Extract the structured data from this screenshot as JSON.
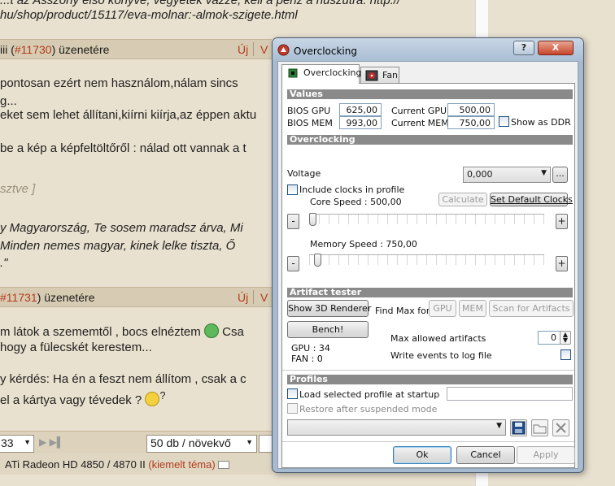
{
  "forum": {
    "top_line1": "...t az Asszony első könyve, vegyétek vázze, kell a pénz a húszutra: http://",
    "top_line2": "hu/shop/product/15117/eva-molnar:-almok-szigete.html",
    "msg1_header_prefix": "iii (",
    "msg1_header_link": "#11730",
    "msg1_header_suffix": ") üzenetére",
    "new_label": "Új",
    "v_label": "V",
    "msg1_line1": "pontosan ezért nem használom,nálam sincs",
    "msg1_line2": "g...",
    "msg1_line3": "eket sem lehet állítani,kiírni kiírja,az éppen aktu",
    "msg1_line4": " be a kép a képfeltöltőről : nálad ott vannak a t",
    "msg1_edited": "sztve ]",
    "sig_line1": "y Magyarország, Te sosem maradsz árva, Mi",
    "sig_line2": "Minden nemes magyar, kinek lelke tiszta, Ő",
    "sig_line3": ".\"",
    "msg2_header_link": "#11731",
    "msg2_header_suffix": ") üzenetére",
    "msg2_line1": "m látok a szememtől , bocs elnéztem",
    "msg2_line1b": "Csa",
    "msg2_line2": "hogy a fülecskét kerestem...",
    "msg2_line3": "y kérdés: Ha én a feszt nem állítom , csak a c",
    "msg2_line4": "el a kártya vagy tévedek ?",
    "msg2_line4b": "?",
    "page_value": "33",
    "per_page": "50 db / növekvő",
    "card_name": "ATi Radeon HD 4850 / 4870 II",
    "card_tag": "(kiemelt téma)"
  },
  "dialog": {
    "title": "Overclocking",
    "help_label": "?",
    "close_label": "X",
    "tabs": [
      {
        "label": "Overclocking",
        "icon": "chip-icon"
      },
      {
        "label": "Fan",
        "icon": "fan-icon"
      }
    ],
    "values_section": "Values",
    "bios_gpu_label": "BIOS GPU",
    "bios_gpu_value": "625,00",
    "bios_mem_label": "BIOS MEM",
    "bios_mem_value": "993,00",
    "current_gpu_label": "Current GPU",
    "current_gpu_value": "500,00",
    "current_mem_label": "Current MEM",
    "current_mem_value": "750,00",
    "show_ddr_label": "Show as DDR",
    "overclocking_section": "Overclocking",
    "voltage_label": "Voltage",
    "voltage_value": "0,000",
    "ellipsis_label": "...",
    "include_clocks_label": "Include clocks in profile",
    "core_speed_label": "Core Speed : 500,00",
    "calculate_label": "Calculate",
    "set_default_label": "Set Default Clocks",
    "memory_speed_label": "Memory Speed : 750,00",
    "minus_label": "-",
    "plus_label": "+",
    "core_slider_level": 0.0,
    "memory_slider_level": 0.02,
    "artifact_section": "Artifact tester",
    "show_3d_label": "Show 3D Renderer",
    "find_max_label": "Find Max for",
    "gpu_btn_label": "GPU",
    "mem_btn_label": "MEM",
    "scan_label": "Scan for Artifacts",
    "bench_label": "Bench!",
    "max_artifacts_label": "Max allowed artifacts",
    "max_artifacts_value": "0",
    "gpu_stat": "GPU : 34",
    "fan_stat": "FAN : 0",
    "write_events_label": "Write events to log file",
    "profiles_section": "Profiles",
    "load_profile_label": "Load selected profile at startup",
    "restore_label": "Restore after suspended mode",
    "ok_label": "Ok",
    "cancel_label": "Cancel",
    "apply_label": "Apply"
  }
}
